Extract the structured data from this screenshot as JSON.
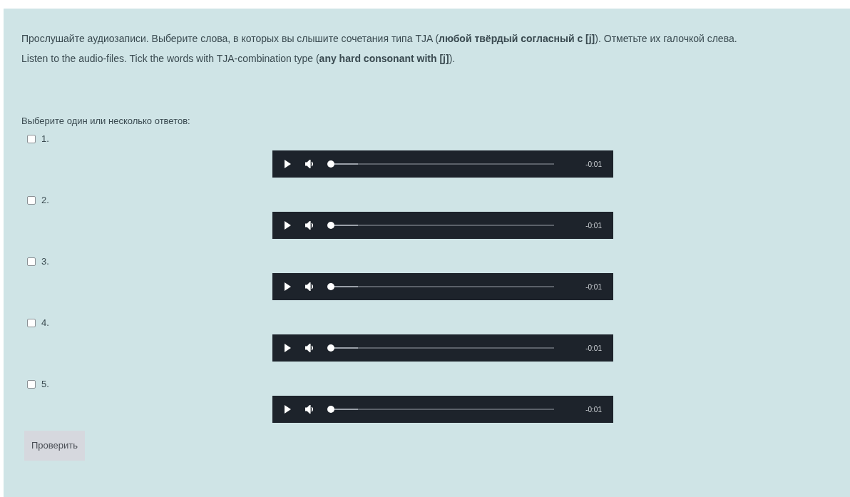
{
  "instructions": [
    "Прослушайте аудиозаписи. Выберите слова, в которых вы слышите сочетания типа TJA (**любой твёрдый согласный с [j]**). Отметьте их галочкой слева.",
    "Listen to the audio-files. Tick the words with TJA-combination type (**any hard consonant with [j]**)."
  ],
  "prompt": "Выберите один или несколько ответов:",
  "answers": [
    {
      "label": "1.",
      "checked": false,
      "player": {
        "level": 0,
        "time": "-0:01"
      }
    },
    {
      "label": "2.",
      "checked": false,
      "player": {
        "level": 0,
        "time": "-0:01"
      }
    },
    {
      "label": "3.",
      "checked": false,
      "player": {
        "level": 0,
        "time": "-0:01"
      }
    },
    {
      "label": "4.",
      "checked": false,
      "player": {
        "level": 0,
        "time": "-0:01"
      }
    },
    {
      "label": "5.",
      "checked": false,
      "player": {
        "level": 0,
        "time": "-0:01"
      }
    }
  ],
  "check_button": "Проверить"
}
